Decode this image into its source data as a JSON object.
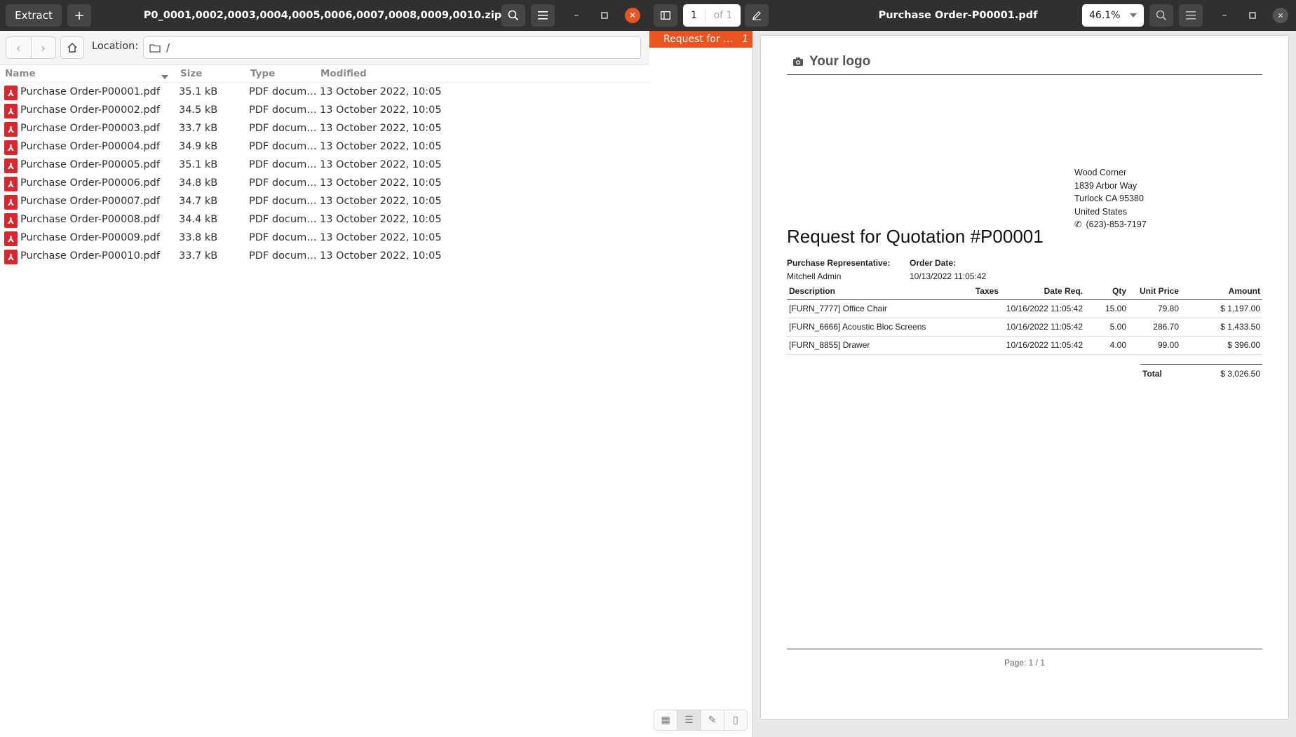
{
  "archive": {
    "title": "P0_0001,0002,0003,0004,0005,0006,0007,0008,0009,0010.zip",
    "extract_label": "Extract",
    "add_label": "+",
    "location_label": "Location:",
    "location_path": "/",
    "columns": {
      "name": "Name",
      "size": "Size",
      "type": "Type",
      "modified": "Modified"
    },
    "files": [
      {
        "name": "Purchase Order-P00001.pdf",
        "size": "35.1 kB",
        "type": "PDF docum…",
        "modified": "13 October 2022, 10:05"
      },
      {
        "name": "Purchase Order-P00002.pdf",
        "size": "34.5 kB",
        "type": "PDF docum…",
        "modified": "13 October 2022, 10:05"
      },
      {
        "name": "Purchase Order-P00003.pdf",
        "size": "33.7 kB",
        "type": "PDF docum…",
        "modified": "13 October 2022, 10:05"
      },
      {
        "name": "Purchase Order-P00004.pdf",
        "size": "34.9 kB",
        "type": "PDF docum…",
        "modified": "13 October 2022, 10:05"
      },
      {
        "name": "Purchase Order-P00005.pdf",
        "size": "35.1 kB",
        "type": "PDF docum…",
        "modified": "13 October 2022, 10:05"
      },
      {
        "name": "Purchase Order-P00006.pdf",
        "size": "34.8 kB",
        "type": "PDF docum…",
        "modified": "13 October 2022, 10:05"
      },
      {
        "name": "Purchase Order-P00007.pdf",
        "size": "34.7 kB",
        "type": "PDF docum…",
        "modified": "13 October 2022, 10:05"
      },
      {
        "name": "Purchase Order-P00008.pdf",
        "size": "34.4 kB",
        "type": "PDF docum…",
        "modified": "13 October 2022, 10:05"
      },
      {
        "name": "Purchase Order-P00009.pdf",
        "size": "33.8 kB",
        "type": "PDF docum…",
        "modified": "13 October 2022, 10:05"
      },
      {
        "name": "Purchase Order-P00010.pdf",
        "size": "33.7 kB",
        "type": "PDF docum…",
        "modified": "13 October 2022, 10:05"
      }
    ]
  },
  "viewer": {
    "title": "Purchase Order-P00001.pdf",
    "page_current": "1",
    "page_of": "of 1",
    "zoom": "46.1%",
    "outline_item": "Request for …",
    "outline_page": "1"
  },
  "document": {
    "logo": "Your logo",
    "address": [
      "Wood Corner",
      "1839 Arbor Way",
      "Turlock CA 95380",
      "United States"
    ],
    "phone": "(623)-853-7197",
    "title": "Request for Quotation #P00001",
    "rep_label": "Purchase Representative:",
    "rep_value": "Mitchell Admin",
    "date_label": "Order Date:",
    "date_value": "10/13/2022 11:05:42",
    "table_headers": {
      "description": "Description",
      "taxes": "Taxes",
      "date_req": "Date Req.",
      "qty": "Qty",
      "unit_price": "Unit Price",
      "amount": "Amount"
    },
    "lines": [
      {
        "description": "[FURN_7777] Office Chair",
        "taxes": "",
        "date_req": "10/16/2022 11:05:42",
        "qty": "15.00",
        "unit_price": "79.80",
        "amount": "$ 1,197.00"
      },
      {
        "description": "[FURN_6666] Acoustic Bloc Screens",
        "taxes": "",
        "date_req": "10/16/2022 11:05:42",
        "qty": "5.00",
        "unit_price": "286.70",
        "amount": "$ 1,433.50"
      },
      {
        "description": "[FURN_8855] Drawer",
        "taxes": "",
        "date_req": "10/16/2022 11:05:42",
        "qty": "4.00",
        "unit_price": "99.00",
        "amount": "$ 396.00"
      }
    ],
    "total_label": "Total",
    "total_value": "$ 3,026.50",
    "footer": "Page: 1 / 1"
  },
  "colors": {
    "accent": "#e95420",
    "headerbar": "#303030",
    "pdf_icon": "#d9272e"
  }
}
